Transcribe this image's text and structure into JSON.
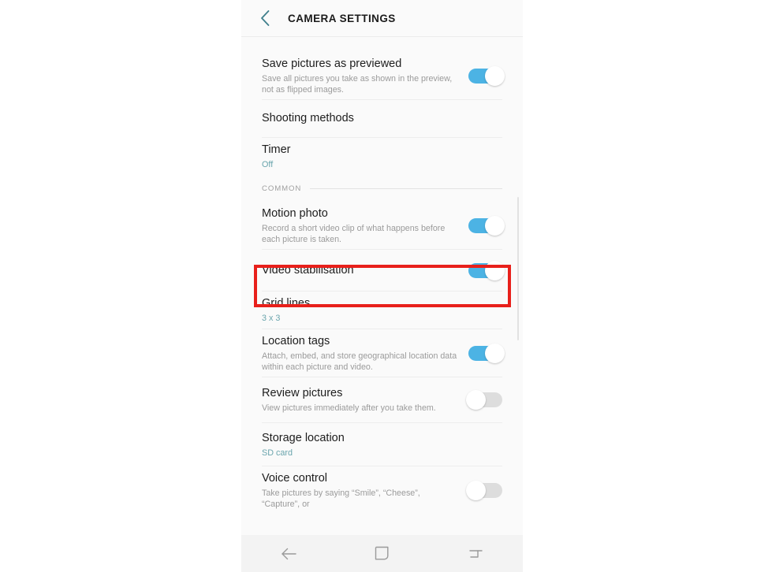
{
  "header": {
    "back_icon": "chevron-left-icon",
    "title": "CAMERA SETTINGS",
    "back_color": "#3f7f8c"
  },
  "colors": {
    "toggle_on": "#4cb3e4",
    "toggle_off": "#dddddd",
    "value_text": "#6aa5ad",
    "highlight": "#e8201b",
    "screen_bg": "#fafafa",
    "navbar_bg": "#f3f3f3"
  },
  "settings": [
    {
      "name": "save-pictures-as-previewed",
      "title": "Save pictures as previewed",
      "desc": "Save all pictures you take as shown in the preview, not as flipped images.",
      "control": "toggle",
      "state": "on"
    },
    {
      "name": "shooting-methods",
      "title": "Shooting methods",
      "control": "none"
    },
    {
      "name": "timer",
      "title": "Timer",
      "value": "Off",
      "control": "none"
    }
  ],
  "section": {
    "name": "common",
    "label": "COMMON"
  },
  "common_settings": [
    {
      "name": "motion-photo",
      "title": "Motion photo",
      "desc": "Record a short video clip of what happens before each picture is taken.",
      "control": "toggle",
      "state": "on"
    },
    {
      "name": "video-stabilisation",
      "title": "Video stabilisation",
      "control": "toggle",
      "state": "on",
      "highlighted": true
    },
    {
      "name": "grid-lines",
      "title": "Grid lines",
      "value": "3 x 3",
      "control": "none"
    },
    {
      "name": "location-tags",
      "title": "Location tags",
      "desc": "Attach, embed, and store geographical location data within each picture and video.",
      "control": "toggle",
      "state": "on"
    },
    {
      "name": "review-pictures",
      "title": "Review pictures",
      "desc": "View pictures immediately after you take them.",
      "control": "toggle",
      "state": "off"
    },
    {
      "name": "storage-location",
      "title": "Storage location",
      "value": "SD card",
      "control": "none"
    },
    {
      "name": "voice-control",
      "title": "Voice control",
      "desc": "Take pictures by saying “Smile”, “Cheese”, “Capture”, or",
      "control": "toggle",
      "state": "off"
    }
  ],
  "navbar": {
    "back_icon": "back-arrow-icon",
    "home_icon": "home-square-icon",
    "recents_icon": "recents-icon"
  }
}
